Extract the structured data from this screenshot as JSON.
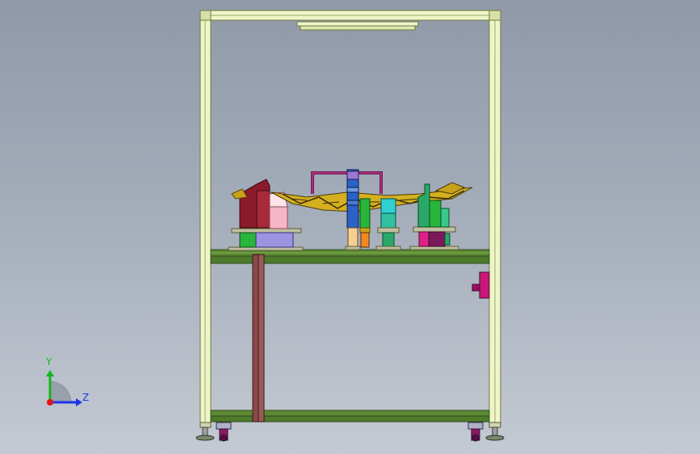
{
  "triad": {
    "y_label": "Y",
    "z_label": "Z",
    "y_color": "#12b81e",
    "z_color": "#1d35e8",
    "x_color": "#e01414"
  },
  "model": {
    "frame_color": "#eef5c8",
    "frame_edge": "#6f7a3c",
    "plate_color": "#4e7a2c",
    "fixture_colors": {
      "dark_red": "#8b1a2a",
      "pink": "#f7b6c8",
      "lavender": "#9c94e0",
      "green": "#27b53a",
      "teal": "#2aa86a",
      "cyan": "#30d0d0",
      "orange": "#f08a20",
      "magenta": "#e0208a",
      "purple": "#7a1a5a",
      "gold": "#c9a21a",
      "blue": "#2a62c8",
      "peach": "#f5cf92"
    }
  }
}
